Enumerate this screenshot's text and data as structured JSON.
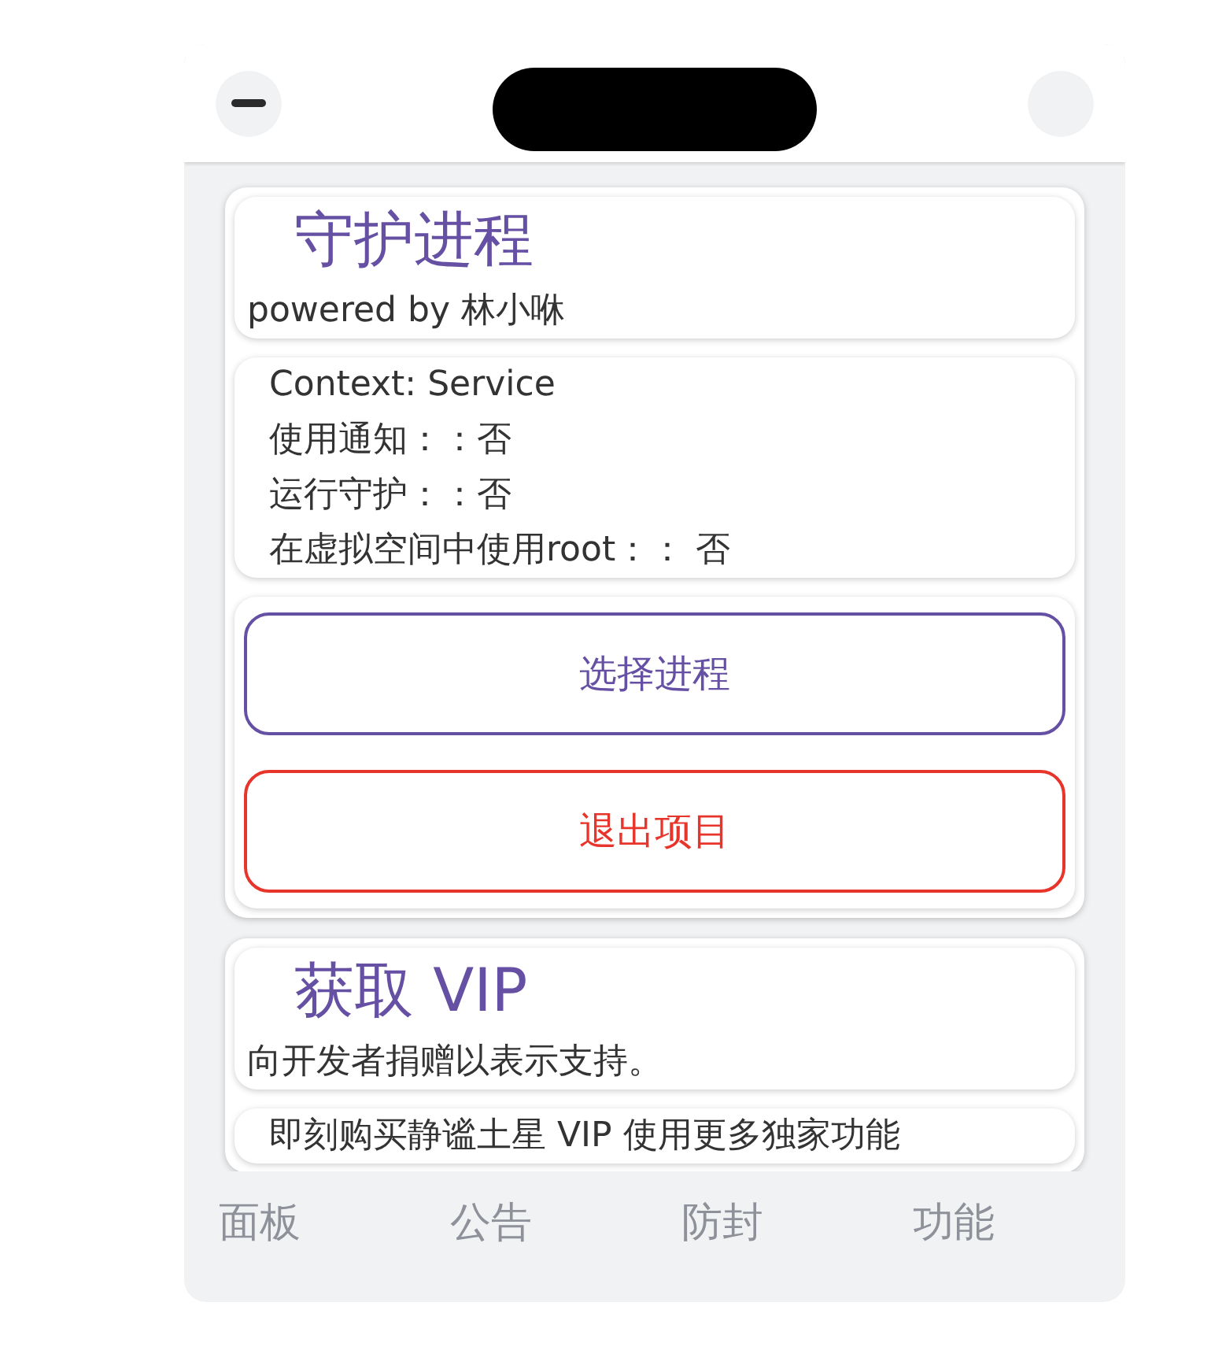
{
  "cards": [
    {
      "title": "守护进程",
      "subtitle": "powered by 林小咻",
      "sections": [
        {
          "kind": "text",
          "lines": [
            "Context: Service",
            "使用通知：：否",
            "运行守护：：否",
            "在虚拟空间中使用root：： 否"
          ]
        },
        {
          "kind": "buttons",
          "buttons": [
            {
              "label": "选择进程",
              "color": "#6650a4"
            },
            {
              "label": "退出项目",
              "color": "#e8352c"
            }
          ]
        }
      ]
    },
    {
      "title": "获取 VIP",
      "subtitle": "向开发者捐赠以表示支持。",
      "sections": [
        {
          "kind": "text",
          "lines": [
            "即刻购买静谧土星 VIP 使用更多独家功能"
          ]
        }
      ]
    }
  ],
  "bottom_nav": [
    {
      "label": "面板"
    },
    {
      "label": "公告"
    },
    {
      "label": "防封"
    },
    {
      "label": "功能"
    }
  ]
}
